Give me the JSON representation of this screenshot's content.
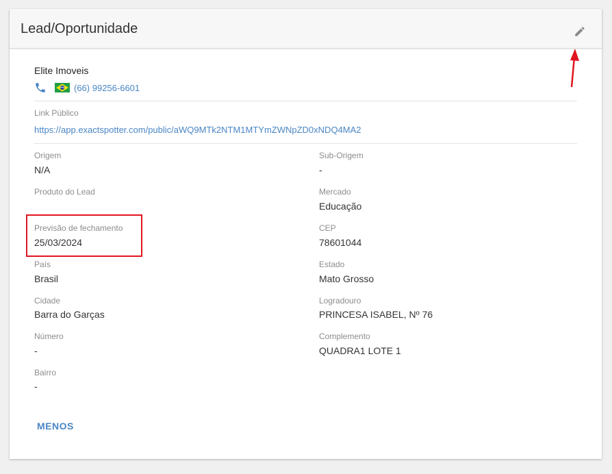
{
  "header": {
    "title": "Lead/Oportunidade",
    "edit_icon": "pencil-icon"
  },
  "lead": {
    "name": "Elite Imoveis",
    "phone_icon": "phone-icon",
    "flag_icon": "brazil-flag-icon",
    "phone": "(66) 99256-6601"
  },
  "public_link": {
    "label": "Link Público",
    "url": "https://app.exactspotter.com/public/aWQ9MTk2NTM1MTYmZWNpZD0xNDQ4MA2"
  },
  "fields": {
    "origem": {
      "label": "Origem",
      "value": "N/A"
    },
    "sub_origem": {
      "label": "Sub-Origem",
      "value": "-"
    },
    "produto": {
      "label": "Produto do Lead",
      "value": ""
    },
    "mercado": {
      "label": "Mercado",
      "value": "Educação"
    },
    "previsao": {
      "label": "Previsão de fechamento",
      "value": "25/03/2024"
    },
    "cep": {
      "label": "CEP",
      "value": "78601044"
    },
    "pais": {
      "label": "País",
      "value": "Brasil"
    },
    "estado": {
      "label": "Estado",
      "value": "Mato Grosso"
    },
    "cidade": {
      "label": "Cidade",
      "value": "Barra do Garças"
    },
    "logradouro": {
      "label": "Logradouro",
      "value": "PRINCESA ISABEL, Nº 76"
    },
    "numero": {
      "label": "Número",
      "value": "-"
    },
    "complemento": {
      "label": "Complemento",
      "value": "QUADRA1 LOTE 1"
    },
    "bairro": {
      "label": "Bairro",
      "value": "-"
    }
  },
  "actions": {
    "less_label": "MENOS"
  },
  "colors": {
    "link": "#4a86c5",
    "annotation": "#e0141e",
    "header_bg": "#f7f7f7"
  }
}
